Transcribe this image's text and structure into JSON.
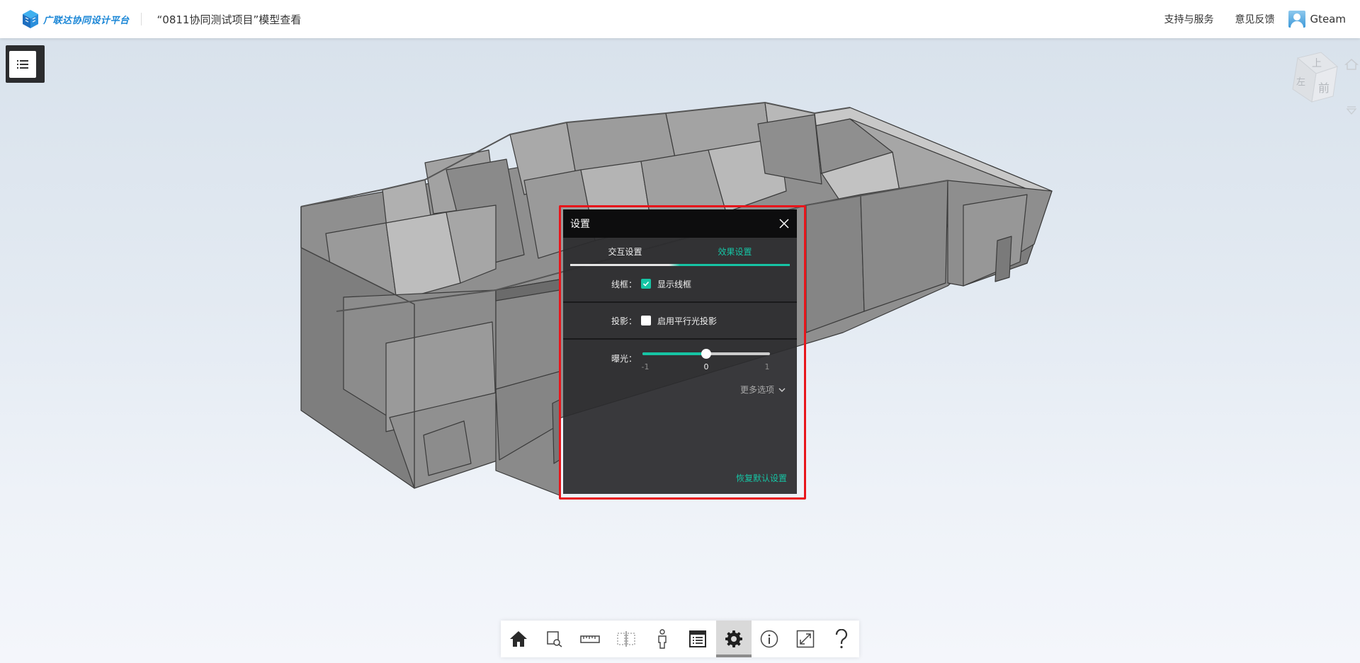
{
  "header": {
    "logo_text": "广联达协同设计平台",
    "project_title": "“0811协同测试项目”模型查看",
    "links": [
      "支持与服务",
      "意见反馈"
    ],
    "user_name": "Gteam"
  },
  "viewcube": {
    "top_face": "上",
    "front_face": "前",
    "left_face": "左"
  },
  "settings_dialog": {
    "title": "设置",
    "tabs": [
      {
        "label": "交互设置",
        "active": false
      },
      {
        "label": "效果设置",
        "active": true
      }
    ],
    "wireframe": {
      "label": "线框：",
      "option": "显示线框",
      "checked": true
    },
    "shadow": {
      "label": "投影：",
      "option": "启用平行光投影",
      "checked": false
    },
    "exposure": {
      "label": "曝光：",
      "min": "-1",
      "value": "0",
      "max": "1",
      "fraction": 0.5
    },
    "more_options": "更多选项",
    "restore_default": "恢复默认设置"
  },
  "toolbar": {
    "tools": [
      {
        "icon": "home-icon",
        "active": false
      },
      {
        "icon": "zoom-to-area-icon",
        "active": false
      },
      {
        "icon": "measure-ruler-icon",
        "active": false
      },
      {
        "icon": "section-box-icon",
        "active": false
      },
      {
        "icon": "walk-person-icon",
        "active": false
      },
      {
        "icon": "property-list-icon",
        "active": false
      },
      {
        "icon": "settings-gear-icon",
        "active": true
      },
      {
        "icon": "info-icon",
        "active": false
      },
      {
        "icon": "fullscreen-icon",
        "active": false
      },
      {
        "icon": "help-icon",
        "active": false
      }
    ]
  },
  "colors": {
    "accent": "#16c4a4",
    "highlight_border": "#e8151b",
    "brand_blue": "#1a86d6"
  }
}
